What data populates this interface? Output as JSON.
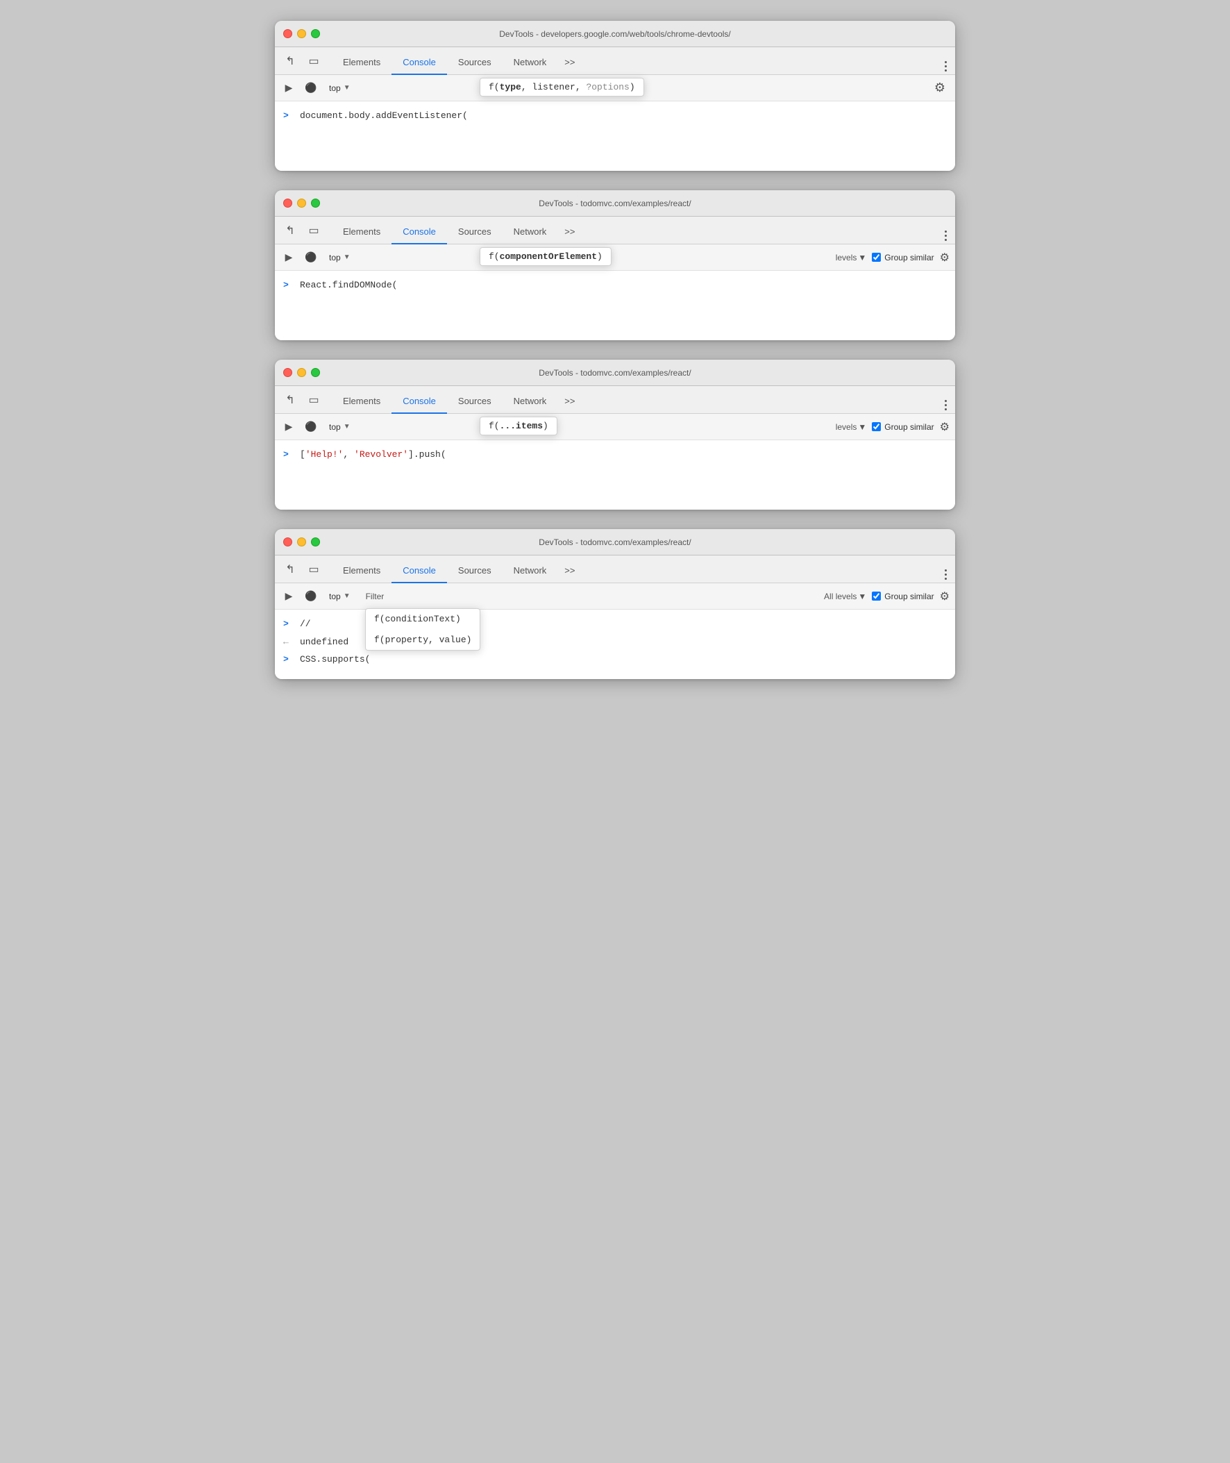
{
  "windows": [
    {
      "id": "window-1",
      "title": "DevTools - developers.google.com/web/tools/chrome-devtools/",
      "tabs": [
        "Elements",
        "Console",
        "Sources",
        "Network",
        ">>"
      ],
      "active_tab": "Console",
      "toolbar": {
        "context": "top",
        "has_filter": false,
        "has_levels": false,
        "has_group": false
      },
      "autocomplete": {
        "text": "f(type, listener, ?options)",
        "bold_part": "type",
        "optional_part": "?options"
      },
      "console_lines": [
        {
          "type": "input",
          "prompt": ">",
          "code": "document.body.addEventListener("
        }
      ]
    },
    {
      "id": "window-2",
      "title": "DevTools - todomvc.com/examples/react/",
      "tabs": [
        "Elements",
        "Console",
        "Sources",
        "Network",
        ">>"
      ],
      "active_tab": "Console",
      "toolbar": {
        "context": "top",
        "has_filter": false,
        "has_levels": true,
        "has_group": true
      },
      "autocomplete": {
        "text": "f(componentOrElement)",
        "bold_part": "componentOrElement",
        "optional_part": ""
      },
      "console_lines": [
        {
          "type": "input",
          "prompt": ">",
          "code": "React.findDOMNode("
        }
      ]
    },
    {
      "id": "window-3",
      "title": "DevTools - todomvc.com/examples/react/",
      "tabs": [
        "Elements",
        "Console",
        "Sources",
        "Network",
        ">>"
      ],
      "active_tab": "Console",
      "toolbar": {
        "context": "top",
        "has_filter": false,
        "has_levels": true,
        "has_group": true
      },
      "autocomplete": {
        "text": "f(...items)",
        "bold_part": "...items",
        "optional_part": ""
      },
      "console_lines": [
        {
          "type": "input",
          "prompt": ">",
          "code_parts": [
            {
              "text": "[",
              "class": ""
            },
            {
              "text": "'Help!'",
              "class": "str"
            },
            {
              "text": ", ",
              "class": ""
            },
            {
              "text": "'Revolver'",
              "class": "str"
            },
            {
              "text": "].push(",
              "class": ""
            }
          ]
        }
      ]
    },
    {
      "id": "window-4",
      "title": "DevTools - todomvc.com/examples/react/",
      "tabs": [
        "Elements",
        "Console",
        "Sources",
        "Network",
        ">>"
      ],
      "active_tab": "Console",
      "toolbar": {
        "context": "top",
        "filter_label": "Filter",
        "levels_label": "All levels",
        "has_levels": true,
        "has_group": true,
        "group_label": "Group similar"
      },
      "autocomplete_multi": [
        {
          "text": "f(conditionText)",
          "bold": "conditionText"
        },
        {
          "text": "f(property, value)",
          "bold": "property, value"
        }
      ],
      "console_lines": [
        {
          "type": "input",
          "prompt": ">",
          "code": "//"
        },
        {
          "type": "output",
          "prompt": "<-",
          "code": "undefined",
          "code_class": "undefined-val"
        },
        {
          "type": "input",
          "prompt": ">",
          "code": "CSS.supports("
        }
      ]
    }
  ],
  "labels": {
    "elements": "Elements",
    "console": "Console",
    "sources": "Sources",
    "network": "Network",
    "more": ">>",
    "top": "top",
    "filter": "Filter",
    "all_levels": "All levels",
    "group_similar": "Group similar"
  }
}
